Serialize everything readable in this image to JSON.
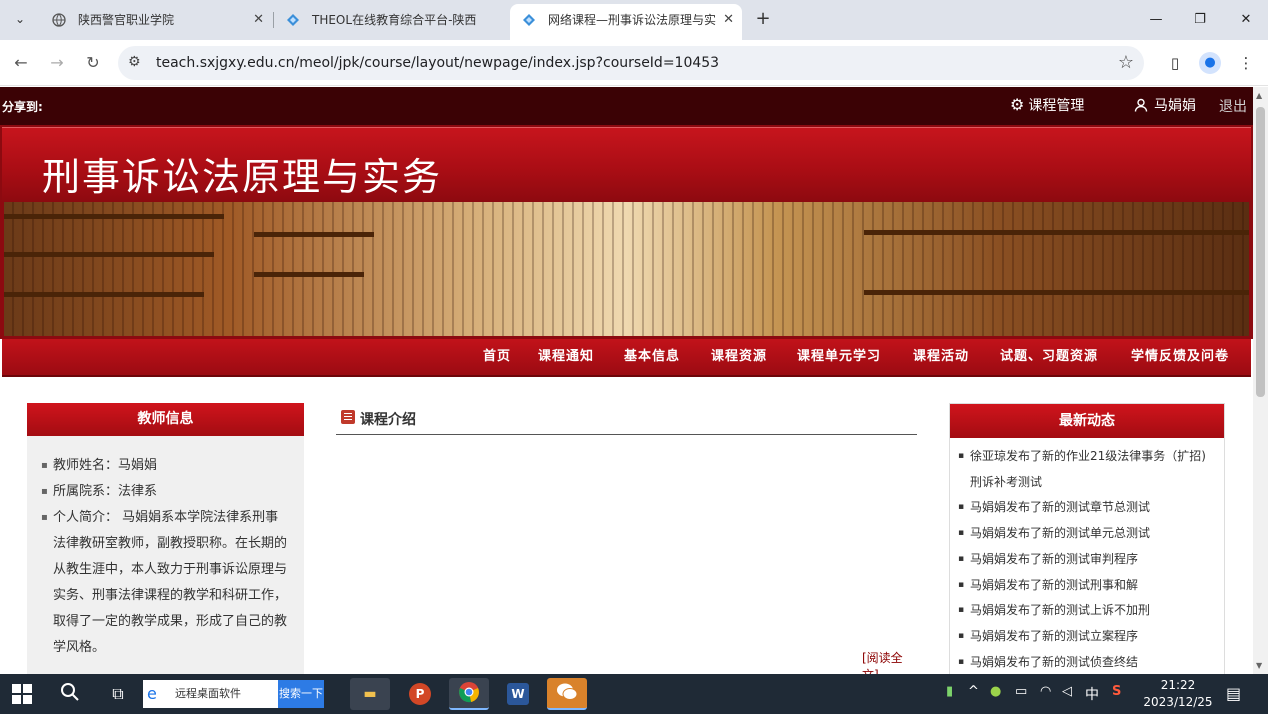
{
  "browser": {
    "tabs": [
      {
        "title": "陕西警官职业学院"
      },
      {
        "title": "THEOL在线教育综合平台-陕西"
      },
      {
        "title": "网络课程—刑事诉讼法原理与实"
      }
    ],
    "url": "teach.sxjgxy.edu.cn/meol/jpk/course/layout/newpage/index.jsp?courseId=10453"
  },
  "topbar": {
    "share_label": "分享到:",
    "course_mgmt": "课程管理",
    "user_name": "马娟娟",
    "logout": "退出"
  },
  "course": {
    "title": "刑事诉讼法原理与实务"
  },
  "nav": {
    "items": [
      "首页",
      "课程通知",
      "基本信息",
      "课程资源",
      "课程单元学习",
      "课程活动",
      "试题、习题资源",
      "学情反馈及问卷"
    ]
  },
  "teacher": {
    "heading": "教师信息",
    "name": "教师姓名：马娟娟",
    "dept": "所属院系：法律系",
    "bio": "个人简介： 马娟娟系本学院法律系刑事法律教研室教师，副教授职称。在长期的从教生涯中，本人致力于刑事诉讼原理与实务、刑事法律课程的教学和科研工作，取得了一定的教学成果，形成了自己的教学风格。"
  },
  "intro": {
    "heading": "课程介绍",
    "read_more": "[阅读全文]"
  },
  "news": {
    "heading": "最新动态",
    "items": [
      "徐亚琼发布了新的作业21级法律事务（扩招)刑诉补考测试",
      "马娟娟发布了新的测试章节总测试",
      "马娟娟发布了新的测试单元总测试",
      "马娟娟发布了新的测试审判程序",
      "马娟娟发布了新的测试刑事和解",
      "马娟娟发布了新的测试上诉不加刑",
      "马娟娟发布了新的测试立案程序",
      "马娟娟发布了新的测试侦查终结"
    ]
  },
  "taskbar": {
    "search_text": "远程桌面软件",
    "search_button": "搜索一下",
    "ime": "中",
    "time": "21:22",
    "date": "2023/12/25"
  }
}
